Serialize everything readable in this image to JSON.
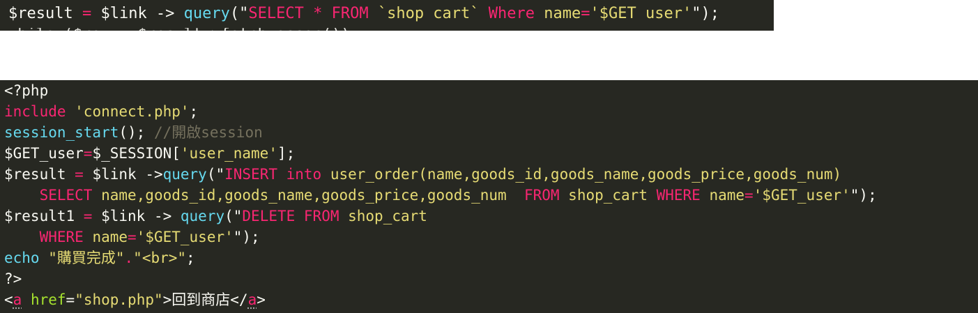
{
  "colors": {
    "background": "#272822",
    "default": "#f8f8f2",
    "keyword": "#f92672",
    "function": "#66d9ef",
    "string": "#e6db74",
    "comment": "#75715e",
    "attribute": "#a6e22e"
  },
  "top_snippet": {
    "lines": [
      {
        "tokens": [
          {
            "t": "$result ",
            "c": "txt"
          },
          {
            "t": "=",
            "c": "kw"
          },
          {
            "t": " $link -> ",
            "c": "txt"
          },
          {
            "t": "query",
            "c": "fn"
          },
          {
            "t": "(\"",
            "c": "txt"
          },
          {
            "t": "SELECT * FROM",
            "c": "kw"
          },
          {
            "t": " `shop cart` ",
            "c": "str"
          },
          {
            "t": "Where",
            "c": "kw"
          },
          {
            "t": " name",
            "c": "str"
          },
          {
            "t": "=",
            "c": "kw"
          },
          {
            "t": "'$GET user'",
            "c": "str"
          },
          {
            "t": "\");",
            "c": "txt"
          }
        ]
      },
      {
        "tokens": [
          {
            "t": "while ($row = $result->fetch_assoc())",
            "c": "txt"
          }
        ]
      }
    ]
  },
  "main_snippet": {
    "lines": [
      {
        "tokens": [
          {
            "t": "<?php",
            "c": "txt"
          }
        ]
      },
      {
        "tokens": [
          {
            "t": "include",
            "c": "kw"
          },
          {
            "t": " 'connect.php'",
            "c": "str"
          },
          {
            "t": ";",
            "c": "txt"
          }
        ]
      },
      {
        "tokens": [
          {
            "t": "session_start",
            "c": "fn"
          },
          {
            "t": "(); ",
            "c": "txt"
          },
          {
            "t": "//開啟session",
            "c": "cmt"
          }
        ]
      },
      {
        "tokens": [
          {
            "t": "$GET_user",
            "c": "txt"
          },
          {
            "t": "=",
            "c": "kw"
          },
          {
            "t": "$_SESSION[",
            "c": "txt"
          },
          {
            "t": "'user_name'",
            "c": "str"
          },
          {
            "t": "];",
            "c": "txt"
          }
        ]
      },
      {
        "tokens": [
          {
            "t": "$result ",
            "c": "txt"
          },
          {
            "t": "=",
            "c": "kw"
          },
          {
            "t": " $link ->",
            "c": "txt"
          },
          {
            "t": "query",
            "c": "fn"
          },
          {
            "t": "(\"",
            "c": "txt"
          },
          {
            "t": "INSERT into",
            "c": "kw"
          },
          {
            "t": " user_order(name,goods_id,goods_name,goods_price,goods_num)",
            "c": "str"
          }
        ]
      },
      {
        "tokens": [
          {
            "t": "    ",
            "c": "txt"
          },
          {
            "t": "SELECT",
            "c": "kw"
          },
          {
            "t": " name,goods_id,goods_name,goods_price,goods_num  ",
            "c": "str"
          },
          {
            "t": "FROM",
            "c": "kw"
          },
          {
            "t": " shop_cart ",
            "c": "str"
          },
          {
            "t": "WHERE",
            "c": "kw"
          },
          {
            "t": " name",
            "c": "str"
          },
          {
            "t": "=",
            "c": "kw"
          },
          {
            "t": "'$GET_user'",
            "c": "str"
          },
          {
            "t": "\");",
            "c": "txt"
          }
        ]
      },
      {
        "tokens": [
          {
            "t": "$result1 ",
            "c": "txt"
          },
          {
            "t": "=",
            "c": "kw"
          },
          {
            "t": " $link -> ",
            "c": "txt"
          },
          {
            "t": "query",
            "c": "fn"
          },
          {
            "t": "(\"",
            "c": "txt"
          },
          {
            "t": "DELETE FROM",
            "c": "kw"
          },
          {
            "t": " shop_cart",
            "c": "str"
          }
        ]
      },
      {
        "tokens": [
          {
            "t": "    ",
            "c": "txt"
          },
          {
            "t": "WHERE",
            "c": "kw"
          },
          {
            "t": " name",
            "c": "str"
          },
          {
            "t": "=",
            "c": "kw"
          },
          {
            "t": "'$GET_user'",
            "c": "str"
          },
          {
            "t": "\");",
            "c": "txt"
          }
        ]
      },
      {
        "tokens": [
          {
            "t": "echo",
            "c": "fn"
          },
          {
            "t": " \"購買完成\"",
            "c": "str"
          },
          {
            "t": ".",
            "c": "kw"
          },
          {
            "t": "\"<br>\"",
            "c": "str"
          },
          {
            "t": ";",
            "c": "txt"
          }
        ]
      },
      {
        "tokens": [
          {
            "t": "?>",
            "c": "txt"
          }
        ]
      },
      {
        "tokens": [
          {
            "t": "<",
            "c": "txt"
          },
          {
            "t": "a",
            "c": "kw",
            "dotted": true
          },
          {
            "t": " ",
            "c": "txt"
          },
          {
            "t": "href",
            "c": "attr"
          },
          {
            "t": "=",
            "c": "txt"
          },
          {
            "t": "\"shop.php\"",
            "c": "str"
          },
          {
            "t": ">回到商店</",
            "c": "txt"
          },
          {
            "t": "a",
            "c": "kw",
            "dotted": true
          },
          {
            "t": ">",
            "c": "txt"
          }
        ]
      }
    ]
  }
}
